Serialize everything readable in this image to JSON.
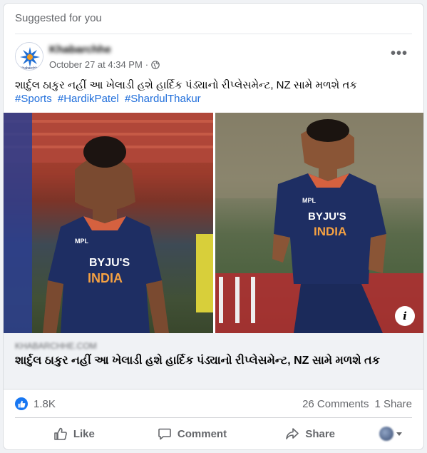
{
  "header": {
    "suggested_label": "Suggested for you"
  },
  "post": {
    "author": "Khabarchhe",
    "avatar_text": "khabarchhe",
    "date": "October 27 at 4:34 PM",
    "separator": "·",
    "text": "શાર્દુલ ઠાકુર નહીં આ ખેલાડી હશે હાર્દિક પંડ્યાનો રીપ્લેસમેન્ટ, NZ સામે મળશે તક",
    "hashtags": [
      "#Sports",
      "#HardikPatel",
      "#ShardulThakur"
    ]
  },
  "link": {
    "domain": "KHABARCHHE.COM",
    "title": "શાર્દુલ ઠાકુર નહીં આ ખેલાડી હશે હાર્દિક પંડ્યાનો રીપ્લેસમેન્ટ, NZ સામે મળશે તક",
    "info_label": "i"
  },
  "jersey": {
    "sponsor": "BYJU'S",
    "country": "INDIA",
    "badge": "MPL"
  },
  "stats": {
    "likes": "1.8K",
    "comments": "26 Comments",
    "shares": "1 Share"
  },
  "actions": {
    "like": "Like",
    "comment": "Comment",
    "share": "Share"
  },
  "more_glyph": "•••",
  "colors": {
    "facebook_blue": "#1877f2",
    "hashtag": "#216fdb",
    "jersey": "#1e2e63"
  }
}
